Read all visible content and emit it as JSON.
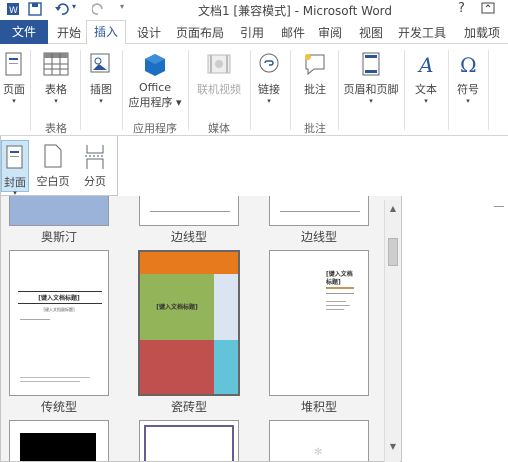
{
  "titlebar": {
    "title": "文档1 [兼容模式] - Microsoft Word",
    "help": "?",
    "minimize": "–",
    "restore": "□"
  },
  "tabs": {
    "file": "文件",
    "home": "开始",
    "insert": "插入",
    "design": "设计",
    "layout": "页面布局",
    "references": "引用",
    "mailings": "邮件",
    "review": "审阅",
    "view": "视图",
    "developer": "开发工具",
    "addins": "加载项"
  },
  "ribbon": {
    "pages": "页面",
    "table": "表格",
    "table_group": "表格",
    "illustrations": "插图",
    "office_apps_line1": "Office",
    "office_apps_line2": "应用程序",
    "apps_group": "应用程序",
    "online_video": "联机视频",
    "media_group": "媒体",
    "link": "链接",
    "comment": "批注",
    "comment_group": "批注",
    "header_footer": "页眉和页脚",
    "text": "文本",
    "symbols": "符号"
  },
  "dropdown": {
    "cover": "封面",
    "blank": "空白页",
    "page_break": "分页"
  },
  "gallery": {
    "row1": [
      "奥斯汀",
      "边线型",
      "边线型"
    ],
    "row2": [
      "传统型",
      "瓷砖型",
      "堆积型"
    ],
    "traditional_title": "[键入文档标题]",
    "traditional_sub": "[键入文档副标题]",
    "tile_title": "[键入文档标题]",
    "stack_title_1": "[键入文档",
    "stack_title_2": "标题]"
  },
  "colors": {
    "accent": "#2b579a",
    "office_blue": "#1d6fc1",
    "tile_orange": "#e67a1c",
    "tile_green": "#94b45a",
    "tile_red": "#c0504d",
    "tile_cyan": "#63c3d9",
    "tile_lightblue": "#dbe5f1",
    "austin_blue": "#9bb3d8"
  }
}
